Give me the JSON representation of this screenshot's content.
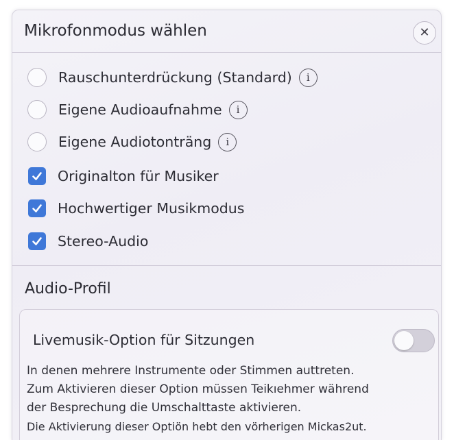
{
  "dialog": {
    "title": "Mikrofonmodus wählen",
    "close_icon": "close-icon"
  },
  "options": [
    {
      "type": "radio",
      "label": "Rauschunterdrückung (Standard)",
      "checked": false,
      "info": true
    },
    {
      "type": "radio",
      "label": "Eigene Audioaufnahme",
      "checked": false,
      "info": true
    },
    {
      "type": "radio",
      "label": "Eigene Audiotonträng",
      "checked": false,
      "info": true
    },
    {
      "type": "checkbox",
      "label": "Originalton für Musiker",
      "checked": true,
      "info": false
    },
    {
      "type": "checkbox",
      "label": "Hochwertiger Musikmodus",
      "checked": true,
      "info": false
    },
    {
      "type": "checkbox",
      "label": "Stereo-Audio",
      "checked": true,
      "info": false
    }
  ],
  "audio_profile": {
    "title": "Audio-Profil",
    "card": {
      "title": "Livemusik-Option für Sitzungen",
      "toggle_on": false,
      "description": [
        "In denen mehrere Instrumente oder Stimmen auttreten.",
        "Zum Aktivieren dieser Option müssen Teikıehmer während",
        "der Besprechung die Umschalttaste aktivieren.",
        "Die Aktivierung dieser Optiön hebt den vörherigen Mickas2ut."
      ]
    }
  },
  "colors": {
    "accent": "#3f78d8",
    "panel_bg": "#f0eef5",
    "border": "#cfcad8"
  }
}
